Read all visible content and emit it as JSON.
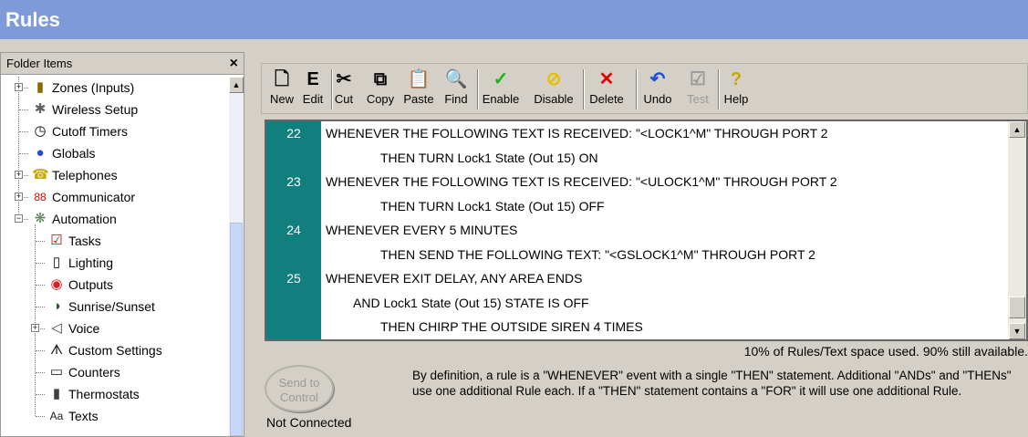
{
  "window": {
    "title": "Rules"
  },
  "folder": {
    "header": "Folder Items",
    "close": "×",
    "items": [
      {
        "label": "Zones (Inputs)",
        "icon": "zones-icon",
        "glyph": "▮",
        "color": "#8a6a00",
        "expander": "+"
      },
      {
        "label": "Wireless Setup",
        "icon": "antenna-icon",
        "glyph": "✱",
        "color": "#606060"
      },
      {
        "label": "Cutoff Timers",
        "icon": "timer-icon",
        "glyph": "◷",
        "color": "#000000"
      },
      {
        "label": "Globals",
        "icon": "globe-icon",
        "glyph": "●",
        "color": "#1a4fd6"
      },
      {
        "label": "Telephones",
        "icon": "telephone-icon",
        "glyph": "☎",
        "color": "#c8a800",
        "expander": "+"
      },
      {
        "label": "Communicator",
        "icon": "communicator-icon",
        "glyph": "88",
        "color": "#e00000",
        "expander": "+"
      },
      {
        "label": "Automation",
        "icon": "automation-icon",
        "glyph": "❋",
        "color": "#5a7a5a",
        "expander": "−"
      },
      {
        "label": "Tasks",
        "icon": "tasks-checkbox-icon",
        "glyph": "☑",
        "color": "#cc0000"
      },
      {
        "label": "Lighting",
        "icon": "lighting-switch-icon",
        "glyph": "▯",
        "color": "#000000"
      },
      {
        "label": "Outputs",
        "icon": "outputs-icon",
        "glyph": "◉",
        "color": "#d42020"
      },
      {
        "label": "Sunrise/Sunset",
        "icon": "sunrise-sunset-icon",
        "glyph": "◑",
        "color": "#2a5a2a"
      },
      {
        "label": "Voice",
        "icon": "speaker-icon",
        "glyph": "◁",
        "color": "#404040",
        "expander": "+"
      },
      {
        "label": "Custom Settings",
        "icon": "custom-settings-icon",
        "glyph": "ᗑ",
        "color": "#202020"
      },
      {
        "label": "Counters",
        "icon": "counters-icon",
        "glyph": "▭",
        "color": "#202020"
      },
      {
        "label": "Thermostats",
        "icon": "thermostat-icon",
        "glyph": "▮",
        "color": "#404040"
      },
      {
        "label": "Texts",
        "icon": "texts-icon",
        "glyph": "Aa",
        "color": "#202020"
      }
    ]
  },
  "toolbar": {
    "buttons": [
      {
        "label": "New",
        "icon": "new-document-icon",
        "glyph": "🗋",
        "color": "#000000"
      },
      {
        "label": "Edit",
        "icon": "edit-icon",
        "glyph": "E",
        "color": "#000000"
      },
      {
        "label": "Cut",
        "icon": "cut-icon",
        "glyph": "✂",
        "color": "#000000"
      },
      {
        "label": "Copy",
        "icon": "copy-icon",
        "glyph": "⧉",
        "color": "#000000"
      },
      {
        "label": "Paste",
        "icon": "paste-icon",
        "glyph": "📋",
        "color": "#000000"
      },
      {
        "label": "Find",
        "icon": "find-icon",
        "glyph": "🔍",
        "color": "#000000"
      },
      {
        "label": "Enable",
        "icon": "enable-check-icon",
        "glyph": "✓",
        "color": "#19b319"
      },
      {
        "label": "Disable",
        "icon": "disable-icon",
        "glyph": "⊘",
        "color": "#e8c000"
      },
      {
        "label": "Delete",
        "icon": "delete-x-icon",
        "glyph": "✕",
        "color": "#e00000"
      },
      {
        "label": "Undo",
        "icon": "undo-icon",
        "glyph": "↶",
        "color": "#1a4fd6"
      },
      {
        "label": "Test",
        "icon": "test-icon",
        "glyph": "☑",
        "color": "#9a9a9a",
        "disabled": true
      },
      {
        "label": "Help",
        "icon": "help-icon",
        "glyph": "?",
        "color": "#c8a800"
      }
    ]
  },
  "rules": {
    "lines": [
      {
        "num": "22",
        "text": "WHENEVER THE FOLLOWING TEXT IS RECEIVED: \"<LOCK1^M\" THROUGH PORT 2",
        "indent": 0
      },
      {
        "num": "",
        "text": "THEN TURN Lock1 State (Out 15) ON",
        "indent": 2
      },
      {
        "num": "23",
        "text": "WHENEVER THE FOLLOWING TEXT IS RECEIVED: \"<ULOCK1^M\" THROUGH PORT 2",
        "indent": 0
      },
      {
        "num": "",
        "text": "THEN TURN Lock1 State (Out 15) OFF",
        "indent": 2
      },
      {
        "num": "24",
        "text": "WHENEVER EVERY 5 MINUTES",
        "indent": 0
      },
      {
        "num": "",
        "text": "THEN SEND THE FOLLOWING TEXT: \"<GSLOCK1^M\" THROUGH PORT 2",
        "indent": 2
      },
      {
        "num": "25",
        "text": "WHENEVER  EXIT DELAY, ANY AREA ENDS",
        "indent": 0
      },
      {
        "num": "",
        "text": "AND Lock1 State (Out 15) STATE IS OFF",
        "indent": 1
      },
      {
        "num": "",
        "text": "THEN CHIRP THE OUTSIDE SIREN 4 TIMES",
        "indent": 2
      }
    ]
  },
  "status": {
    "space_used": "10% of Rules/Text space used.  90% still available.",
    "send_button": "Send to Control",
    "connection": "Not Connected",
    "definition": "By definition, a rule is a \"WHENEVER\" event with a single \"THEN\" statement.  Additional \"ANDs\" and \"THENs\" use one additional Rule each.  If a \"THEN\" statement contains a \"FOR\" it will use one additional Rule."
  }
}
